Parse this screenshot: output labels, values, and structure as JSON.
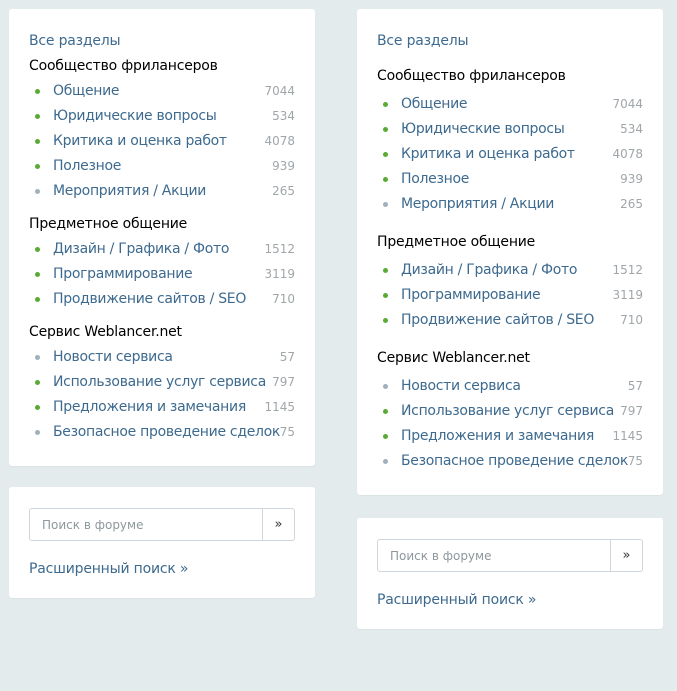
{
  "sidebar": {
    "all_sections": "Все разделы",
    "groups": [
      {
        "title": "Сообщество фрилансеров",
        "items": [
          {
            "label": "Общение",
            "count": "7044",
            "bullet": "green"
          },
          {
            "label": "Юридические вопросы",
            "count": "534",
            "bullet": "green"
          },
          {
            "label": "Критика и оценка работ",
            "count": "4078",
            "bullet": "green"
          },
          {
            "label": "Полезное",
            "count": "939",
            "bullet": "green"
          },
          {
            "label": "Мероприятия / Акции",
            "count": "265",
            "bullet": "grey"
          }
        ]
      },
      {
        "title": "Предметное общение",
        "items": [
          {
            "label": "Дизайн / Графика / Фото",
            "count": "1512",
            "bullet": "green"
          },
          {
            "label": "Программирование",
            "count": "3119",
            "bullet": "green"
          },
          {
            "label": "Продвижение сайтов / SEO",
            "count": "710",
            "bullet": "green"
          }
        ]
      },
      {
        "title": "Сервис Weblancer.net",
        "items": [
          {
            "label": "Новости сервиса",
            "count": "57",
            "bullet": "grey"
          },
          {
            "label": "Использование услуг сервиса",
            "count": "797",
            "bullet": "green"
          },
          {
            "label": "Предложения и замечания",
            "count": "1145",
            "bullet": "green"
          },
          {
            "label": "Безопасное проведение сделок",
            "count": "75",
            "bullet": "grey"
          }
        ]
      }
    ]
  },
  "search": {
    "placeholder": "Поиск в форуме",
    "button_label": "»",
    "advanced_label": "Расширенный поиск »"
  },
  "colors": {
    "background": "#e4ebed",
    "link": "#3d6a8e",
    "bullet_green": "#5aab35",
    "bullet_grey": "#9fb1bb",
    "count": "#a0a6aa"
  }
}
